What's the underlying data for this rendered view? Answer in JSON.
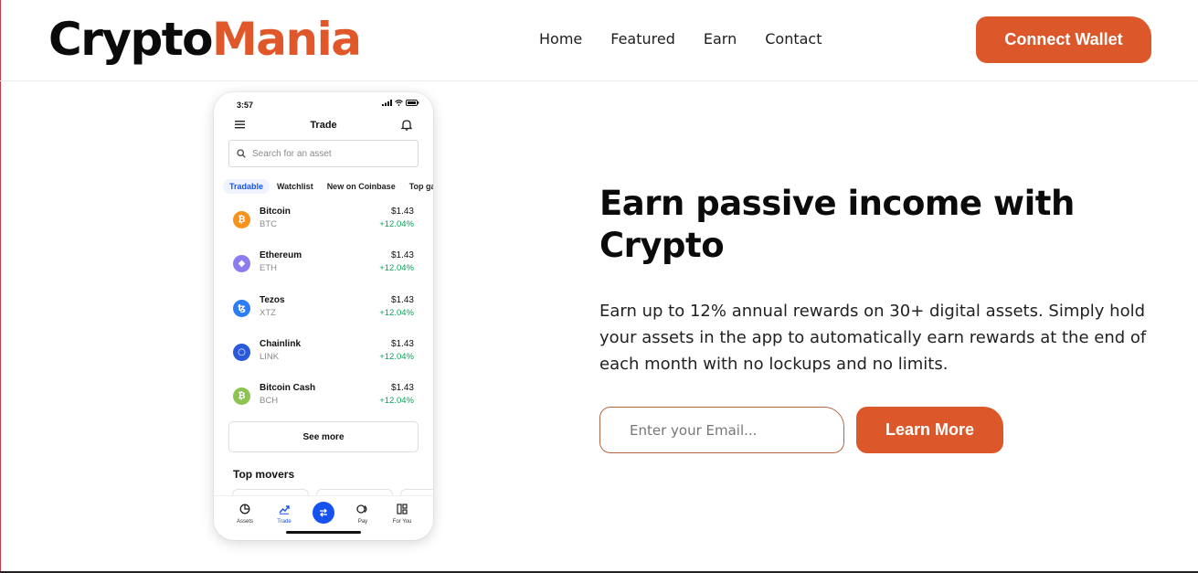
{
  "brand": {
    "part1": "Crypto",
    "part2": "Mania",
    "accent": "#dc582a"
  },
  "nav": {
    "items": [
      "Home",
      "Featured",
      "Earn",
      "Contact"
    ]
  },
  "header": {
    "cta_label": "Connect Wallet"
  },
  "phone": {
    "time": "3:57",
    "title": "Trade",
    "search_placeholder": "Search for an asset",
    "tabs": [
      "Tradable",
      "Watchlist",
      "New on Coinbase",
      "Top gainers"
    ],
    "assets": [
      {
        "name": "Bitcoin",
        "symbol": "BTC",
        "price": "$1.43",
        "change": "+12.04%",
        "icon": "bitcoin-icon",
        "color": "#f7931a",
        "glyph": "₿"
      },
      {
        "name": "Ethereum",
        "symbol": "ETH",
        "price": "$1.43",
        "change": "+12.04%",
        "icon": "ethereum-icon",
        "color": "#8c7cf0",
        "glyph": "◆"
      },
      {
        "name": "Tezos",
        "symbol": "XTZ",
        "price": "$1.43",
        "change": "+12.04%",
        "icon": "tezos-icon",
        "color": "#2c7df7",
        "glyph": "ꜩ"
      },
      {
        "name": "Chainlink",
        "symbol": "LINK",
        "price": "$1.43",
        "change": "+12.04%",
        "icon": "chainlink-icon",
        "color": "#2a5ada",
        "glyph": "○"
      },
      {
        "name": "Bitcoin Cash",
        "symbol": "BCH",
        "price": "$1.43",
        "change": "+12.04%",
        "icon": "bitcoin-cash-icon",
        "color": "#8dc351",
        "glyph": "₿"
      }
    ],
    "see_more": "See more",
    "top_movers": "Top movers",
    "bottom_nav": [
      "Assets",
      "Trade",
      "Pay",
      "For You"
    ],
    "active_color": "#1652f0",
    "positive_color": "#09a35a"
  },
  "hero": {
    "title": "Earn passive income with Crypto",
    "text": "Earn up to 12% annual rewards on 30+ digital assets. Simply hold your assets in the app to automatically earn rewards at the end of each month with no lockups and no limits.",
    "email_placeholder": "Enter your Email...",
    "cta_label": "Learn More"
  }
}
